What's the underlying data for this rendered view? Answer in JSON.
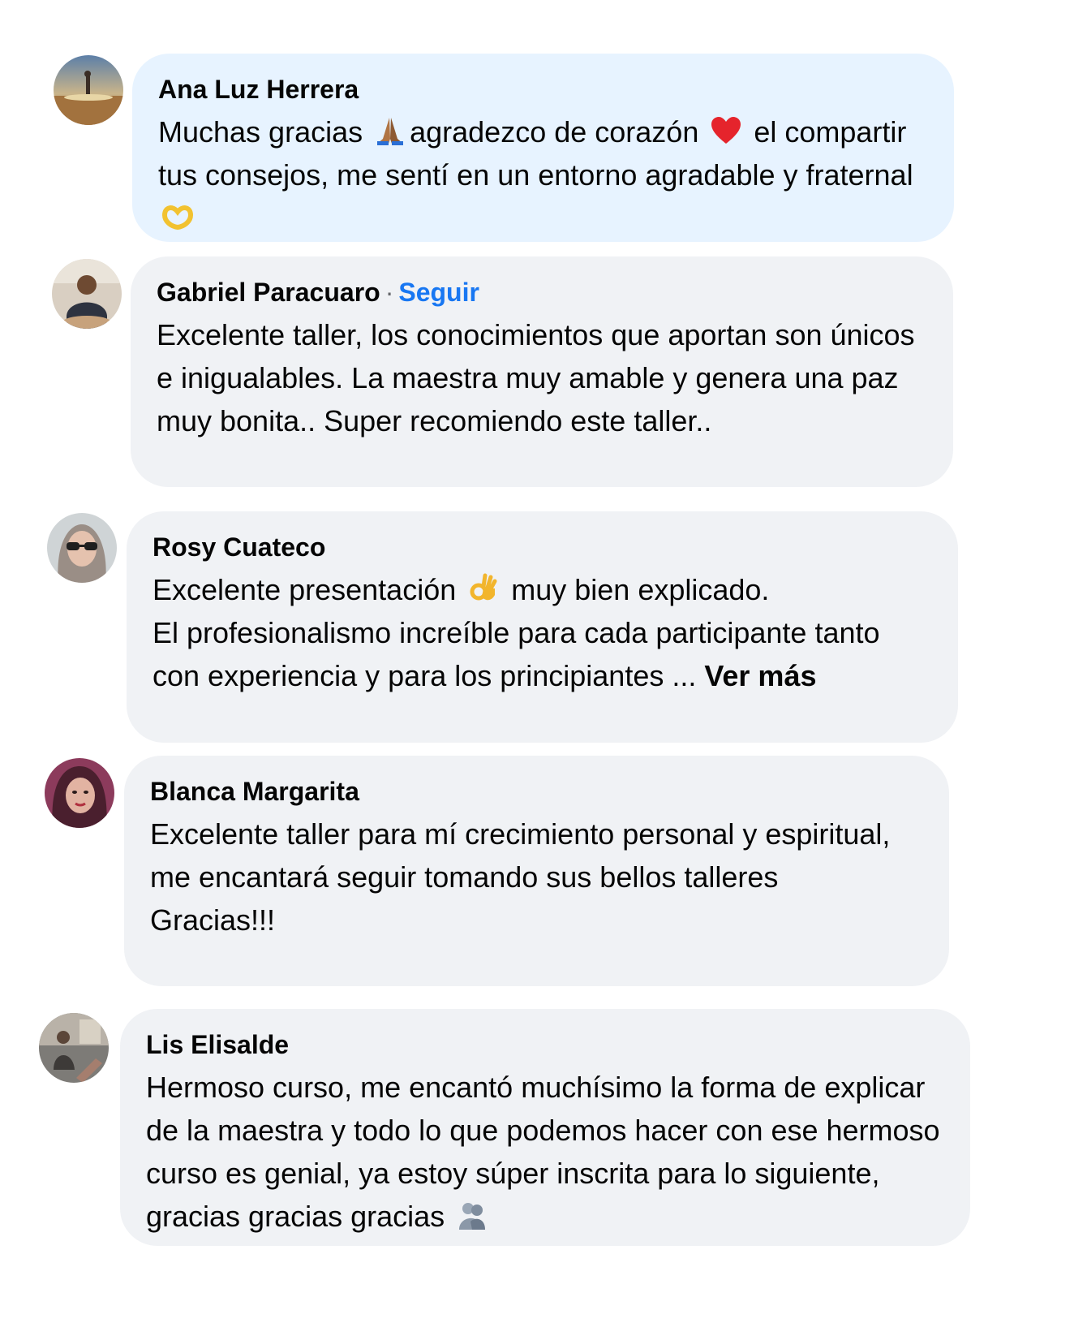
{
  "comments": [
    {
      "author": "Ana Luz Herrera",
      "text_parts": [
        "Muchas gracias ",
        "agradezco de corazón ",
        " el compartir tus consejos, me sentí en un entorno agradable y fraternal "
      ],
      "emojis": [
        "folded-hands",
        "red-heart",
        "heart-hands"
      ]
    },
    {
      "author": "Gabriel Paracuaro",
      "separator": "·",
      "follow_label": "Seguir",
      "text": "Excelente taller, los conocimientos que aportan son únicos e inigualables. La maestra muy amable y genera una paz muy bonita.. Super recomiendo este taller.."
    },
    {
      "author": "Rosy Cuateco",
      "text_parts": [
        "Excelente presentación ",
        " muy bien explicado."
      ],
      "text_line2": "El profesionalismo increíble para cada participante tanto con experiencia y para los principiantes ... ",
      "see_more_label": "Ver más",
      "emojis": [
        "ok-hand"
      ]
    },
    {
      "author": "Blanca Margarita",
      "text": "Excelente taller para mí crecimiento personal y espiritual, me encantará seguir tomando sus bellos talleres",
      "text_line2": "Gracias!!!"
    },
    {
      "author": "Lis Elisalde",
      "text": "Hermoso curso, me encantó muchísimo la forma de explicar de la maestra y todo lo que podemos hacer con ese hermoso curso es genial, ya estoy súper inscrita para lo siguiente, gracias gracias gracias ",
      "emojis": [
        "people-hugging"
      ]
    }
  ],
  "colors": {
    "highlight_bubble": "#e7f3ff",
    "bubble": "#f0f2f5",
    "link": "#1877f2"
  }
}
